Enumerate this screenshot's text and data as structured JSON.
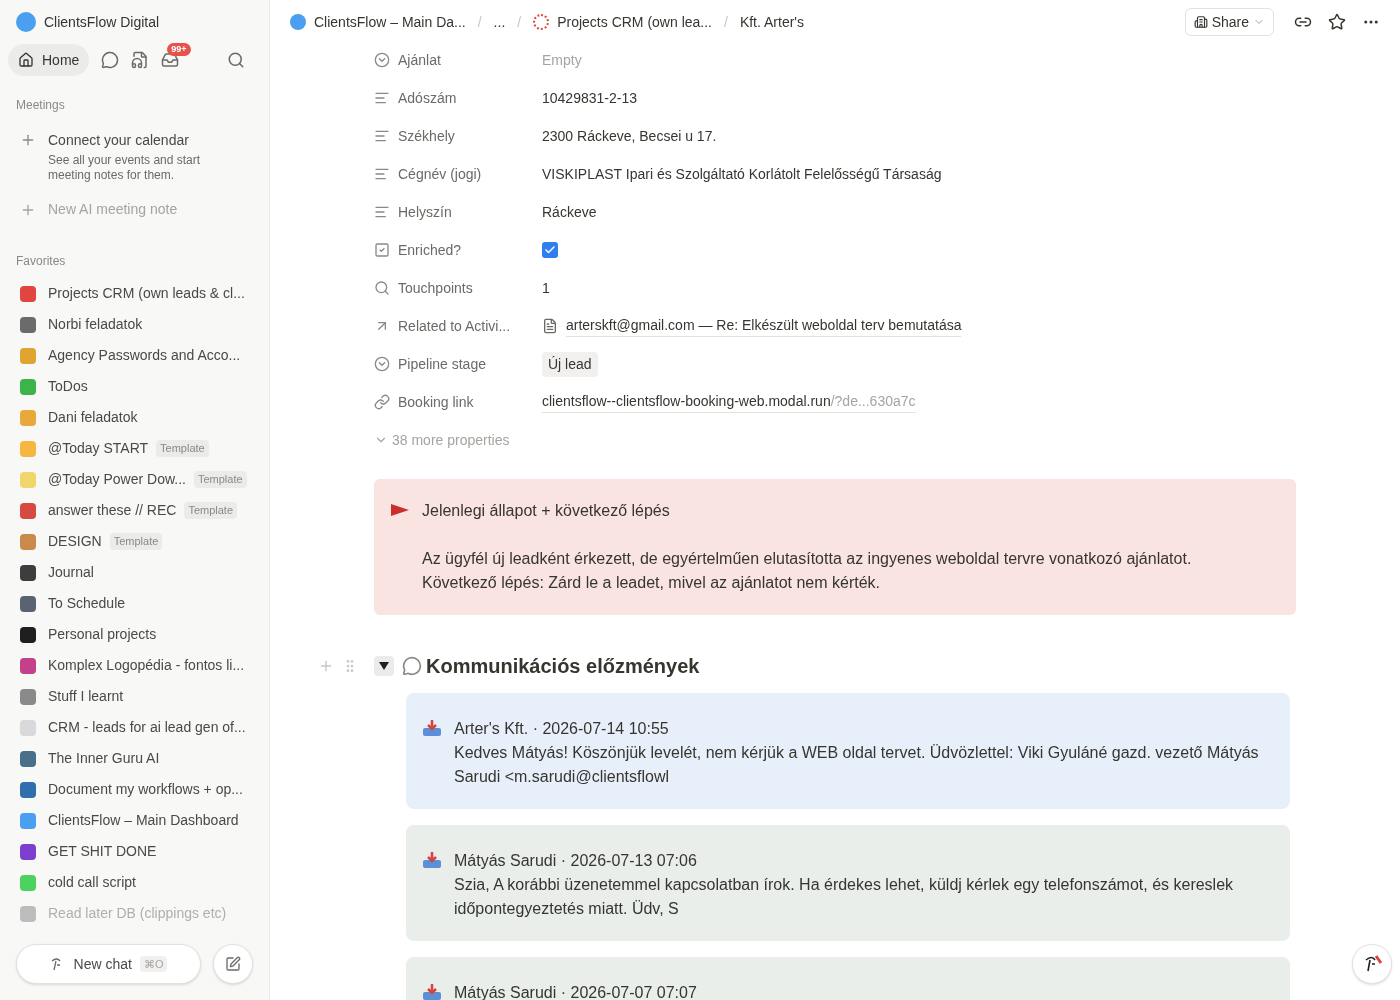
{
  "workspace": {
    "name": "ClientsFlow Digital"
  },
  "nav": {
    "home": "Home",
    "inbox_badge": "99+"
  },
  "meetings": {
    "heading": "Meetings",
    "connect_title": "Connect your calendar",
    "connect_desc": "See all your events and start meeting notes for them.",
    "new_note": "New AI meeting note"
  },
  "favorites": {
    "heading": "Favorites",
    "items": [
      {
        "label": "Projects CRM (own leads & cl...",
        "color": "#e0463e",
        "dimmed": false
      },
      {
        "label": "Norbi feladatok",
        "color": "#6b6b6b",
        "dimmed": false
      },
      {
        "label": "Agency Passwords and Acco...",
        "color": "#e0a430",
        "dimmed": false
      },
      {
        "label": "ToDos",
        "color": "#3cb44a",
        "dimmed": false
      },
      {
        "label": "Dani feladatok",
        "color": "#e8a93a",
        "dimmed": false
      },
      {
        "label": "@Today START",
        "color": "#f5b642",
        "badge": "Template",
        "dimmed": false
      },
      {
        "label": "@Today Power Dow...",
        "color": "#f2d66b",
        "badge": "Template",
        "dimmed": false
      },
      {
        "label": "answer these // REC",
        "color": "#d64a42",
        "badge": "Template",
        "dimmed": false
      },
      {
        "label": "DESIGN",
        "color": "#c98a4b",
        "badge": "Template",
        "dimmed": false
      },
      {
        "label": "Journal",
        "color": "#3d3d3d",
        "dimmed": false
      },
      {
        "label": "To Schedule",
        "color": "#5a6470",
        "dimmed": false
      },
      {
        "label": "Personal projects",
        "color": "#1f1f1f",
        "dimmed": false
      },
      {
        "label": "Komplex Logopédia - fontos li...",
        "color": "#c2418a",
        "dimmed": false
      },
      {
        "label": "Stuff I learnt",
        "color": "#8a8a8a",
        "dimmed": false
      },
      {
        "label": "CRM - leads for ai lead gen of...",
        "color": "#d9d9dc",
        "dimmed": false
      },
      {
        "label": "The Inner Guru AI",
        "color": "#4a6f8a",
        "dimmed": false
      },
      {
        "label": "Document my workflows + op...",
        "color": "#2f6fb0",
        "dimmed": false
      },
      {
        "label": "ClientsFlow – Main Dashboard",
        "color": "#4a9ff0",
        "dimmed": false
      },
      {
        "label": "GET SHIT DONE",
        "color": "#7c3fd0",
        "dimmed": false
      },
      {
        "label": "cold call script",
        "color": "#4cd25f",
        "dimmed": false
      },
      {
        "label": "Read later DB (clippings etc)",
        "color": "#bdbdbd",
        "dimmed": true
      }
    ]
  },
  "new_chat": {
    "label": "New chat",
    "shortcut": "⌘O"
  },
  "breadcrumbs": [
    {
      "label": "ClientsFlow – Main Da...",
      "kind": "logo"
    },
    {
      "separator": "/",
      "label": "...",
      "kind": "plain"
    },
    {
      "separator": "/",
      "label": "Projects CRM (own lea...",
      "kind": "crm"
    },
    {
      "separator": "/",
      "label": "Kft. Arter's",
      "kind": "plain"
    }
  ],
  "share": "Share",
  "properties": [
    {
      "name": "Ajánlat",
      "kind": "select",
      "value": "Empty"
    },
    {
      "name": "Adószám",
      "kind": "text",
      "value": "10429831-2-13"
    },
    {
      "name": "Székhely",
      "kind": "text",
      "value": "2300 Ráckeve, Becsei u 17."
    },
    {
      "name": "Cégnév (jogi)",
      "kind": "text",
      "value": "VISKIPLAST Ipari és Szolgáltató Korlátolt Felelősségű Társaság"
    },
    {
      "name": "Helyszín",
      "kind": "text",
      "value": "Ráckeve"
    },
    {
      "name": "Enriched?",
      "kind": "checkbox",
      "checked": true
    },
    {
      "name": "Touchpoints",
      "kind": "rollup",
      "value": "1"
    },
    {
      "name": "Related to Activi...",
      "kind": "relation",
      "value": "arterskft@gmail.com — Re: Elkészült weboldal terv bemutatása"
    },
    {
      "name": "Pipeline stage",
      "kind": "status",
      "value": "Új lead"
    },
    {
      "name": "Booking link",
      "kind": "url",
      "value": "clientsflow--clientsflow-booking-web.modal.run",
      "suffix": "/?de...630a7c"
    }
  ],
  "more_properties": "38 more properties",
  "callout": {
    "title": "Jelenlegi állapot + következő lépés",
    "body": "Az ügyfél új leadként érkezett, de egyértelműen elutasította az ingyenes weboldal tervre vonatkozó ajánlatot.\nKövetkező lépés: Zárd le a leadet, mivel az ajánlatot nem kérték."
  },
  "toggle": {
    "title": "Kommunikációs előzmények",
    "expanded": true
  },
  "messages": [
    {
      "header": "Arter's Kft. · 2026-07-14 10:55",
      "body": "Kedves Mátyás! Köszönjük levelét, nem kérjük a WEB oldal tervet. Üdvözlettel: Viki Gyuláné gazd. vezető Mátyás Sarudi <m.sarudi@clientsflowl",
      "color": "#e7f0fa"
    },
    {
      "header": "Mátyás Sarudi · 2026-07-13 07:06",
      "body": "Szia, A korábbi üzenetemmel kapcsolatban írok. Ha érdekes lehet, küldj kérlek egy telefonszámot, és kereslek időpontegyeztetés miatt. Üdv, S",
      "color": "#e9eeea"
    },
    {
      "header": "Mátyás Sarudi · 2026-07-07 07:07",
      "color": "#e9eeea"
    }
  ]
}
